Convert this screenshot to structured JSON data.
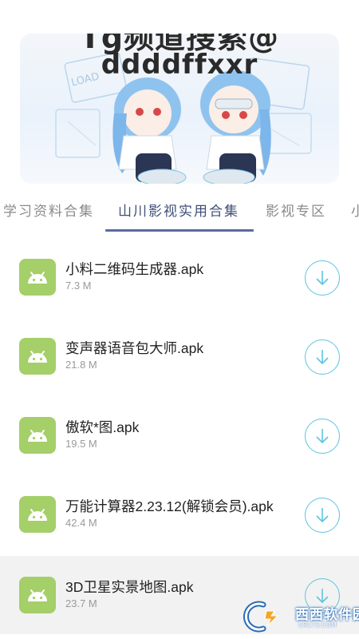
{
  "banner": {
    "line1": "Tg频道搜索@",
    "line2": "ddddffxxr"
  },
  "tabs": [
    {
      "label": "学习资料合集",
      "active": false
    },
    {
      "label": "山川影视实用合集",
      "active": true
    },
    {
      "label": "影视专区",
      "active": false
    },
    {
      "label": "小",
      "active": false
    }
  ],
  "apps": [
    {
      "name": "小料二维码生成器.apk",
      "size": "7.3 M"
    },
    {
      "name": "变声器语音包大师.apk",
      "size": "21.8 M"
    },
    {
      "name": "傲软*图.apk",
      "size": "19.5 M"
    },
    {
      "name": "万能计算器2.23.12(解锁会员).apk",
      "size": "42.4 M"
    },
    {
      "name": "3D卫星实景地图.apk",
      "size": "23.7 M"
    }
  ],
  "watermark": {
    "brand": "西西软件园",
    "domain": "CR173.COM"
  },
  "colors": {
    "tab_active": "#3f4f7a",
    "tab_indicator": "#5b6aa3",
    "android_green": "#a4cf69",
    "download_blue": "#5cc4e0"
  }
}
